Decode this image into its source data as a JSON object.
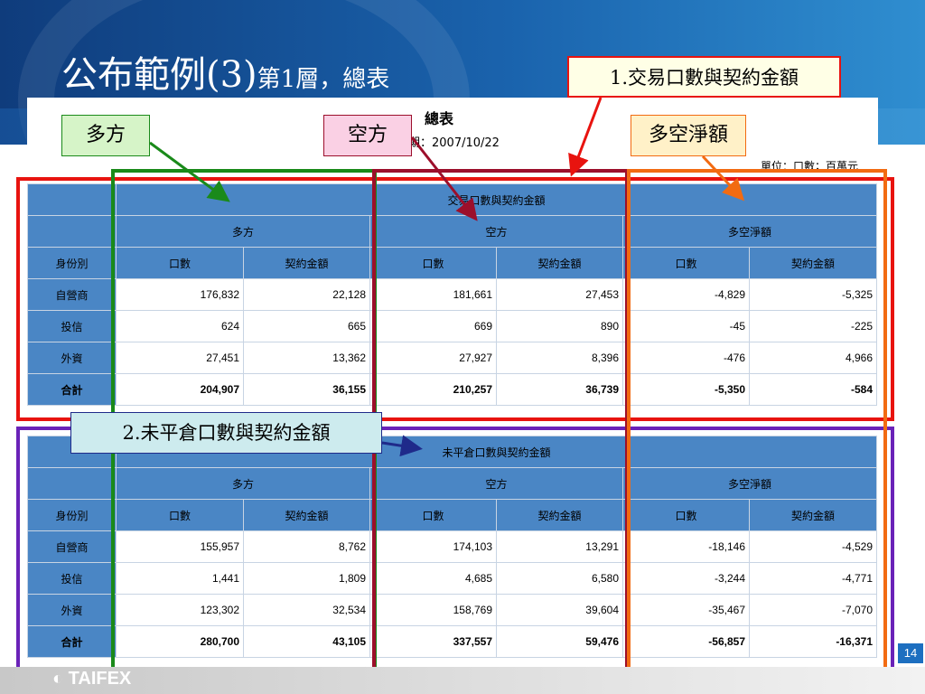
{
  "slide": {
    "title_main": "公布範例(3)",
    "title_sub": "第1層，總表",
    "page_number": "14",
    "logo_text": "TAIFEX"
  },
  "report": {
    "title": "總表",
    "date_label": "期：2007/10/22",
    "unit_label": "單位：口數；百萬元"
  },
  "callouts": {
    "c1": "1.交易口數與契約金額",
    "c2": "2.未平倉口數與契約金額",
    "long": "多方",
    "short": "空方",
    "net": "多空淨額"
  },
  "columns": {
    "long": "多方",
    "short": "空方",
    "net": "多空淨額",
    "row_label": "身份別",
    "lots": "口數",
    "amount": "契約金額"
  },
  "table1": {
    "header": "交易口數與契約金額",
    "rows": [
      {
        "label": "自營商",
        "values": [
          "176,832",
          "22,128",
          "181,661",
          "27,453",
          "-4,829",
          "-5,325"
        ]
      },
      {
        "label": "投信",
        "values": [
          "624",
          "665",
          "669",
          "890",
          "-45",
          "-225"
        ]
      },
      {
        "label": "外資",
        "values": [
          "27,451",
          "13,362",
          "27,927",
          "8,396",
          "-476",
          "4,966"
        ]
      },
      {
        "label": "合計",
        "values": [
          "204,907",
          "36,155",
          "210,257",
          "36,739",
          "-5,350",
          "-584"
        ]
      }
    ]
  },
  "table2": {
    "header": "未平倉口數與契約金額",
    "rows": [
      {
        "label": "自營商",
        "values": [
          "155,957",
          "8,762",
          "174,103",
          "13,291",
          "-18,146",
          "-4,529"
        ]
      },
      {
        "label": "投信",
        "values": [
          "1,441",
          "1,809",
          "4,685",
          "6,580",
          "-3,244",
          "-4,771"
        ]
      },
      {
        "label": "外資",
        "values": [
          "123,302",
          "32,534",
          "158,769",
          "39,604",
          "-35,467",
          "-7,070"
        ]
      },
      {
        "label": "合計",
        "values": [
          "280,700",
          "43,105",
          "337,557",
          "59,476",
          "-56,857",
          "-16,371"
        ]
      }
    ]
  },
  "colors": {
    "red": "#e8130f",
    "green": "#1a8a1a",
    "maroon": "#9c0f2b",
    "orange": "#f26b12",
    "purple": "#6a22b8",
    "navy": "#1f2a8a"
  }
}
